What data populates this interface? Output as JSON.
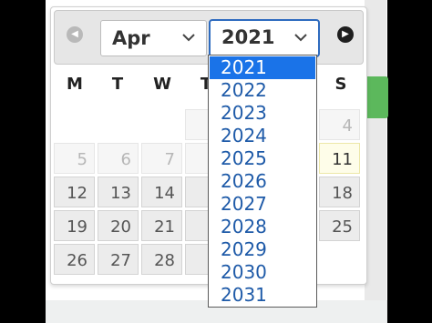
{
  "datepicker": {
    "month_select": {
      "value": "Apr"
    },
    "year_select": {
      "value": "2021"
    },
    "prev_icon": "chevron-left-icon",
    "next_icon": "chevron-right-icon",
    "weekday_headers": [
      "M",
      "T",
      "W",
      "T",
      "S"
    ],
    "visible_days": [
      {
        "label": "4",
        "state": "other-month"
      },
      {
        "label": "5",
        "state": "other-month"
      },
      {
        "label": "6",
        "state": "other-month"
      },
      {
        "label": "7",
        "state": "other-month"
      },
      {
        "label": "11",
        "state": "today"
      },
      {
        "label": "12",
        "state": "normal"
      },
      {
        "label": "13",
        "state": "normal"
      },
      {
        "label": "14",
        "state": "normal"
      },
      {
        "label": "18",
        "state": "normal"
      },
      {
        "label": "19",
        "state": "normal"
      },
      {
        "label": "20",
        "state": "normal"
      },
      {
        "label": "21",
        "state": "normal"
      },
      {
        "label": "25",
        "state": "normal"
      },
      {
        "label": "26",
        "state": "normal"
      },
      {
        "label": "27",
        "state": "normal"
      },
      {
        "label": "28",
        "state": "normal"
      }
    ],
    "year_dropdown": {
      "options": [
        "2021",
        "2022",
        "2023",
        "2024",
        "2025",
        "2026",
        "2027",
        "2028",
        "2029",
        "2030",
        "2031"
      ],
      "selected": "2021"
    }
  },
  "colors": {
    "accent_selected": "#1a73e8",
    "option_text": "#1e5aa8",
    "side_button": "#5cb85c"
  }
}
